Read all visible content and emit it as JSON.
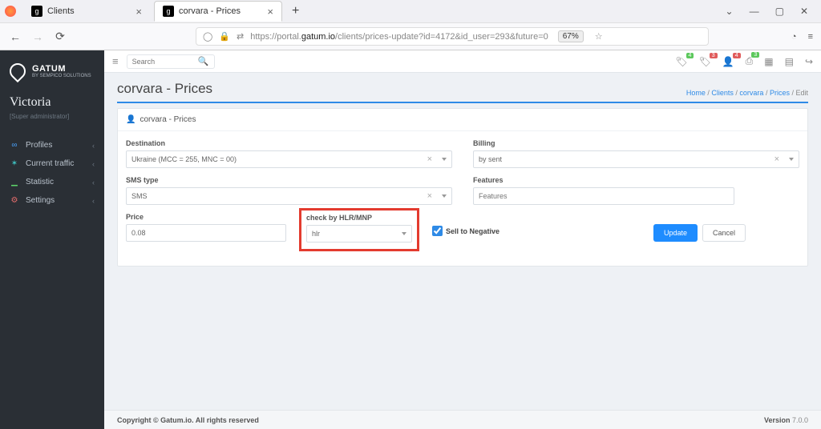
{
  "browser": {
    "tab1": "Clients",
    "tab2": "corvara - Prices",
    "url_host": "gatum.io",
    "url_prefix": "https://portal.",
    "url_path": "/clients/prices-update?id=4172&id_user=293&future=0",
    "zoom": "67%"
  },
  "sidebar": {
    "brand": "GATUM",
    "brand_sub": "BY SEMPICO SOLUTIONS",
    "user": "Victoria",
    "role": "[Super administrator]",
    "items": [
      {
        "label": "Profiles"
      },
      {
        "label": "Current traffic"
      },
      {
        "label": "Statistic"
      },
      {
        "label": "Settings"
      }
    ]
  },
  "topbar": {
    "search_placeholder": "Search",
    "badges": {
      "n1": "4",
      "n2": "3",
      "n3": "4",
      "n4": "3"
    }
  },
  "page": {
    "title": "corvara - Prices",
    "crumbs": {
      "home": "Home",
      "clients": "Clients",
      "corvara": "corvara",
      "prices": "Prices",
      "edit": "Edit"
    },
    "panel_title": "corvara - Prices"
  },
  "form": {
    "destination_label": "Destination",
    "destination_value": "Ukraine (MCC = 255, MNC = 00)",
    "billing_label": "Billing",
    "billing_value": "by sent",
    "smstype_label": "SMS type",
    "smstype_value": "SMS",
    "features_label": "Features",
    "features_placeholder": "Features",
    "price_label": "Price",
    "price_value": "0.08",
    "check_label": "check by HLR/MNP",
    "check_value": "hlr",
    "sell_neg_label": "Sell to Negative",
    "update_btn": "Update",
    "cancel_btn": "Cancel"
  },
  "footer": {
    "copyright": "Copyright © Gatum.io. All rights reserved",
    "version_label": "Version ",
    "version": "7.0.0"
  }
}
